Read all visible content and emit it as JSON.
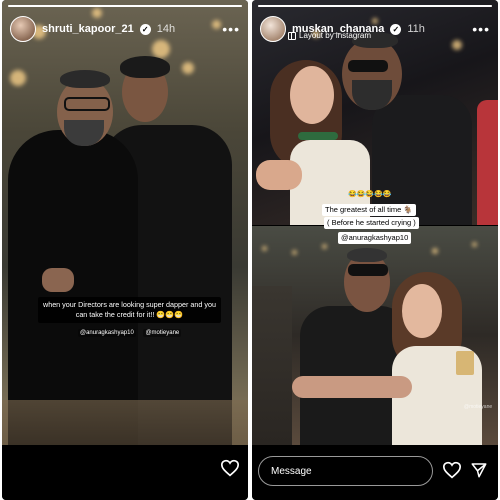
{
  "left_story": {
    "username": "shruti_kapoor_21",
    "timestamp": "14h",
    "progress": 1.0,
    "caption": "when your Directors are looking super dapper and you can take the credit for it!! 😁😁😁",
    "mentions": [
      "@anuragkashyap10",
      "@motieyane"
    ],
    "icons": {
      "verified": "verified-badge-icon",
      "more": "more-options-icon",
      "like": "heart-icon"
    }
  },
  "right_story": {
    "username": "muskan_chanana",
    "timestamp": "11h",
    "layout_label": "Layout by instagram",
    "progress": 1.0,
    "emojis": "😂😂😂😂😂",
    "sticker_lines": [
      "The greatest of all time 🐐",
      "( Before he started crying )"
    ],
    "mention": "@anuragkashyap10",
    "watermark": "@motieyane",
    "message_placeholder": "Message",
    "icons": {
      "verified": "verified-badge-icon",
      "more": "more-options-icon",
      "like": "heart-icon",
      "send": "send-icon",
      "layout": "layout-grid-icon"
    }
  },
  "colors": {
    "background": "#000000",
    "text": "#ffffff",
    "sticker": "#ffffff"
  }
}
